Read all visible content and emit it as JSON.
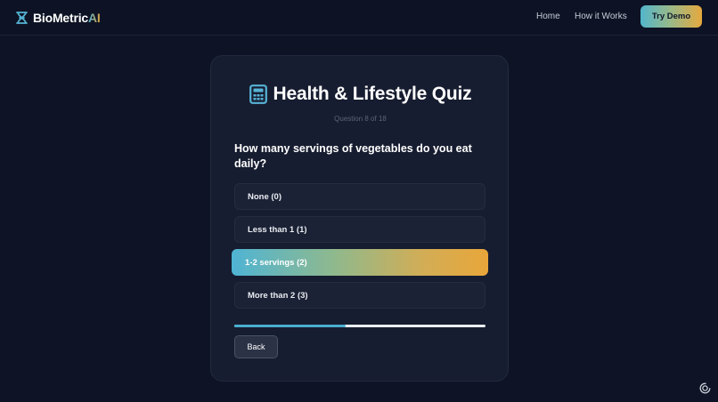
{
  "brand": {
    "name_prefix": "BioMetric",
    "name_suffix": "AI",
    "icon": "dna-icon"
  },
  "nav": {
    "links": [
      "Home",
      "How it Works"
    ],
    "cta_label": "Try Demo"
  },
  "quiz": {
    "title": "Health & Lifestyle Quiz",
    "title_icon": "calculator-icon",
    "progress_text": "Question 8 of 18",
    "question": "How many servings of vegetables do you eat daily?",
    "options": [
      {
        "label": "None (0)",
        "selected": false
      },
      {
        "label": "Less than 1 (1)",
        "selected": false
      },
      {
        "label": "1-2 servings (2)",
        "selected": true
      },
      {
        "label": "More than 2 (3)",
        "selected": false
      }
    ],
    "progress_fraction": 0.444,
    "back_label": "Back"
  },
  "colors": {
    "accent_blue": "#4fb3d3",
    "accent_orange": "#e8a63a",
    "background": "#0e1426",
    "card": "#171d30"
  },
  "widgets": {
    "corner_icon": "assistant-icon"
  }
}
